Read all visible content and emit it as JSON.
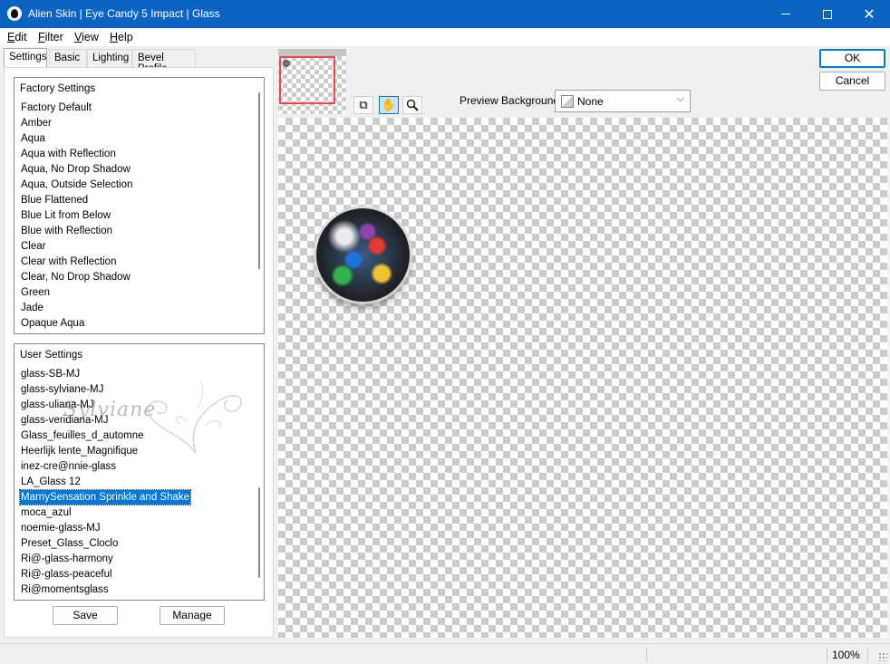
{
  "window": {
    "title": "Alien Skin | Eye Candy 5 Impact | Glass"
  },
  "menu": [
    {
      "label": "Edit",
      "u": "E",
      "rest": "dit"
    },
    {
      "label": "Filter",
      "u": "F",
      "rest": "ilter"
    },
    {
      "label": "View",
      "u": "V",
      "rest": "iew"
    },
    {
      "label": "Help",
      "u": "H",
      "rest": "elp"
    }
  ],
  "tabs": [
    "Settings",
    "Basic",
    "Lighting",
    "Bevel Profile"
  ],
  "factory_settings": {
    "header": "Factory Settings",
    "items": [
      "Factory Default",
      "Amber",
      "Aqua",
      "Aqua with Reflection",
      "Aqua, No Drop Shadow",
      "Aqua, Outside Selection",
      "Blue Flattened",
      "Blue Lit from Below",
      "Blue with Reflection",
      "Clear",
      "Clear with Reflection",
      "Clear, No Drop Shadow",
      "Green",
      "Jade",
      "Opaque Aqua"
    ]
  },
  "user_settings": {
    "header": "User Settings",
    "items": [
      "glass-SB-MJ",
      "glass-sylviane-MJ",
      "glass-uliana-MJ",
      "glass-veridiana-MJ",
      "Glass_feuilles_d_automne",
      "Heerlijk lente_Magnifique",
      "inez-cre@nnie-glass",
      "LA_Glass 12",
      "MarnySensation Sprinkle and Shake",
      "moca_azul",
      "noemie-glass-MJ",
      "Preset_Glass_Cloclo",
      "Ri@-glass-harmony",
      "Ri@-glass-peaceful",
      "Ri@momentsglass"
    ],
    "selected": "MarnySensation Sprinkle and Shake",
    "watermark": "Sylviane"
  },
  "buttons": {
    "save": "Save",
    "manage": "Manage",
    "ok": "OK",
    "cancel": "Cancel"
  },
  "tools": [
    "navigator-icon",
    "hand-icon",
    "zoom-icon"
  ],
  "preview_background": {
    "label": "Preview Background:",
    "value": "None"
  },
  "status": {
    "zoom": "100%"
  },
  "colors": {
    "titlebar": "#0b64c2",
    "selection": "#0078d7",
    "thumb_frame": "#e84b4b"
  }
}
